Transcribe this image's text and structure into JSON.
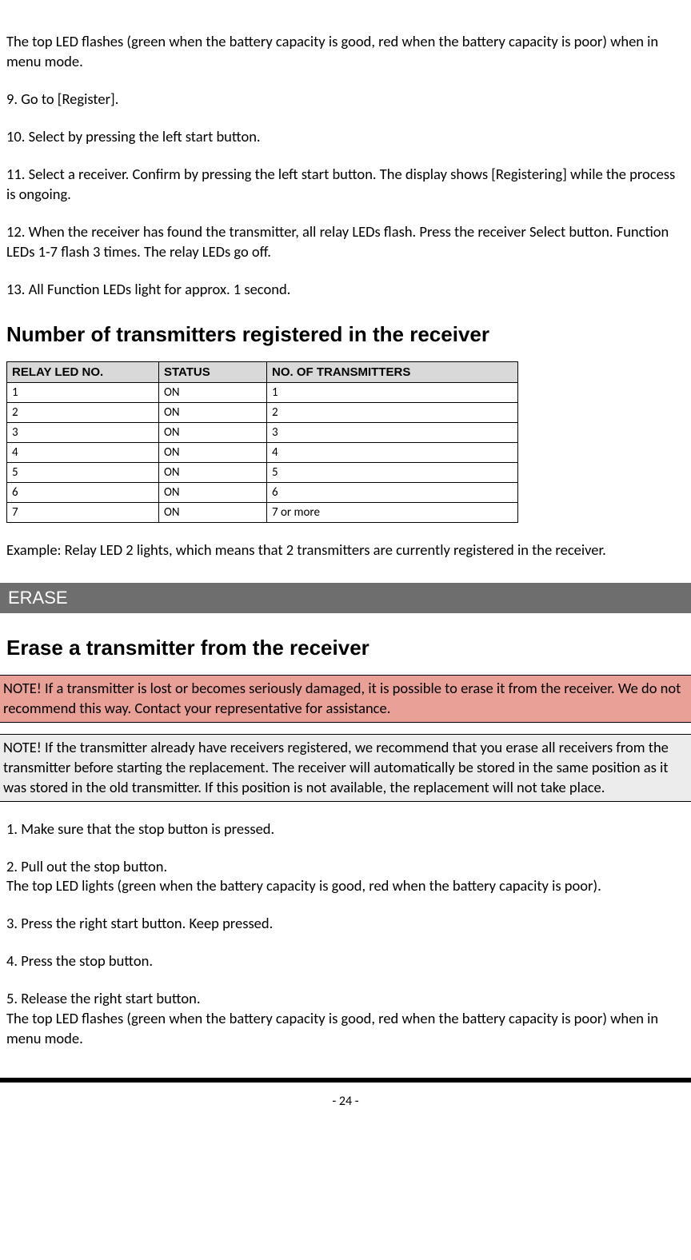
{
  "para1": "The top LED flashes (green when the battery capacity is good, red when the battery capacity is poor) when in menu mode.",
  "step9": "9. Go to [Register].",
  "step10": "10. Select by pressing the left start button.",
  "step11": "11. Select a receiver. Confirm by pressing the left start button. The display shows [Registering] while the process is ongoing.",
  "step12": "12. When the receiver has found the transmitter, all relay LEDs flash. Press the receiver Select button. Function LEDs 1-7 flash 3 times. The relay LEDs go off.",
  "step13": "13. All Function LEDs light for approx. 1 second.",
  "heading_transmitters": "Number of transmitters registered in the receiver",
  "table": {
    "headers": [
      "RELAY LED NO.",
      "STATUS",
      "NO. OF TRANSMITTERS"
    ],
    "rows": [
      [
        "1",
        "ON",
        "1"
      ],
      [
        "2",
        "ON",
        "2"
      ],
      [
        "3",
        "ON",
        "3"
      ],
      [
        "4",
        "ON",
        "4"
      ],
      [
        "5",
        "ON",
        "5"
      ],
      [
        "6",
        "ON",
        "6"
      ],
      [
        "7",
        "ON",
        "7 or more"
      ]
    ]
  },
  "example_text": "Example: Relay LED 2 lights, which means that 2 transmitters are currently registered in the receiver.",
  "section_erase": "ERASE",
  "heading_erase": "Erase a transmitter from the receiver",
  "note_warning": "NOTE! If a transmitter is lost or becomes seriously damaged, it is possible to erase it from the receiver. We do not recommend this way. Contact your representative for assistance.",
  "note_gray": "NOTE! If the transmitter already have receivers registered, we recommend that you erase all receivers from the transmitter before starting the replacement. The receiver will automatically be stored in the same position as it was stored in the old transmitter. If this position is not available, the replacement will not take place.",
  "erase_step1": "1. Make sure that the stop button is pressed.",
  "erase_step2a": "2. Pull out the stop button.",
  "erase_step2b": "The top LED lights (green when the battery capacity is good, red when the battery capacity is poor).",
  "erase_step3": "3. Press the right start button. Keep pressed.",
  "erase_step4": "4. Press the stop button.",
  "erase_step5a": "5. Release the right start button.",
  "erase_step5b": "The top LED flashes (green when the battery capacity is good, red when the battery capacity is poor) when in menu mode.",
  "page_number": "- 24 -"
}
